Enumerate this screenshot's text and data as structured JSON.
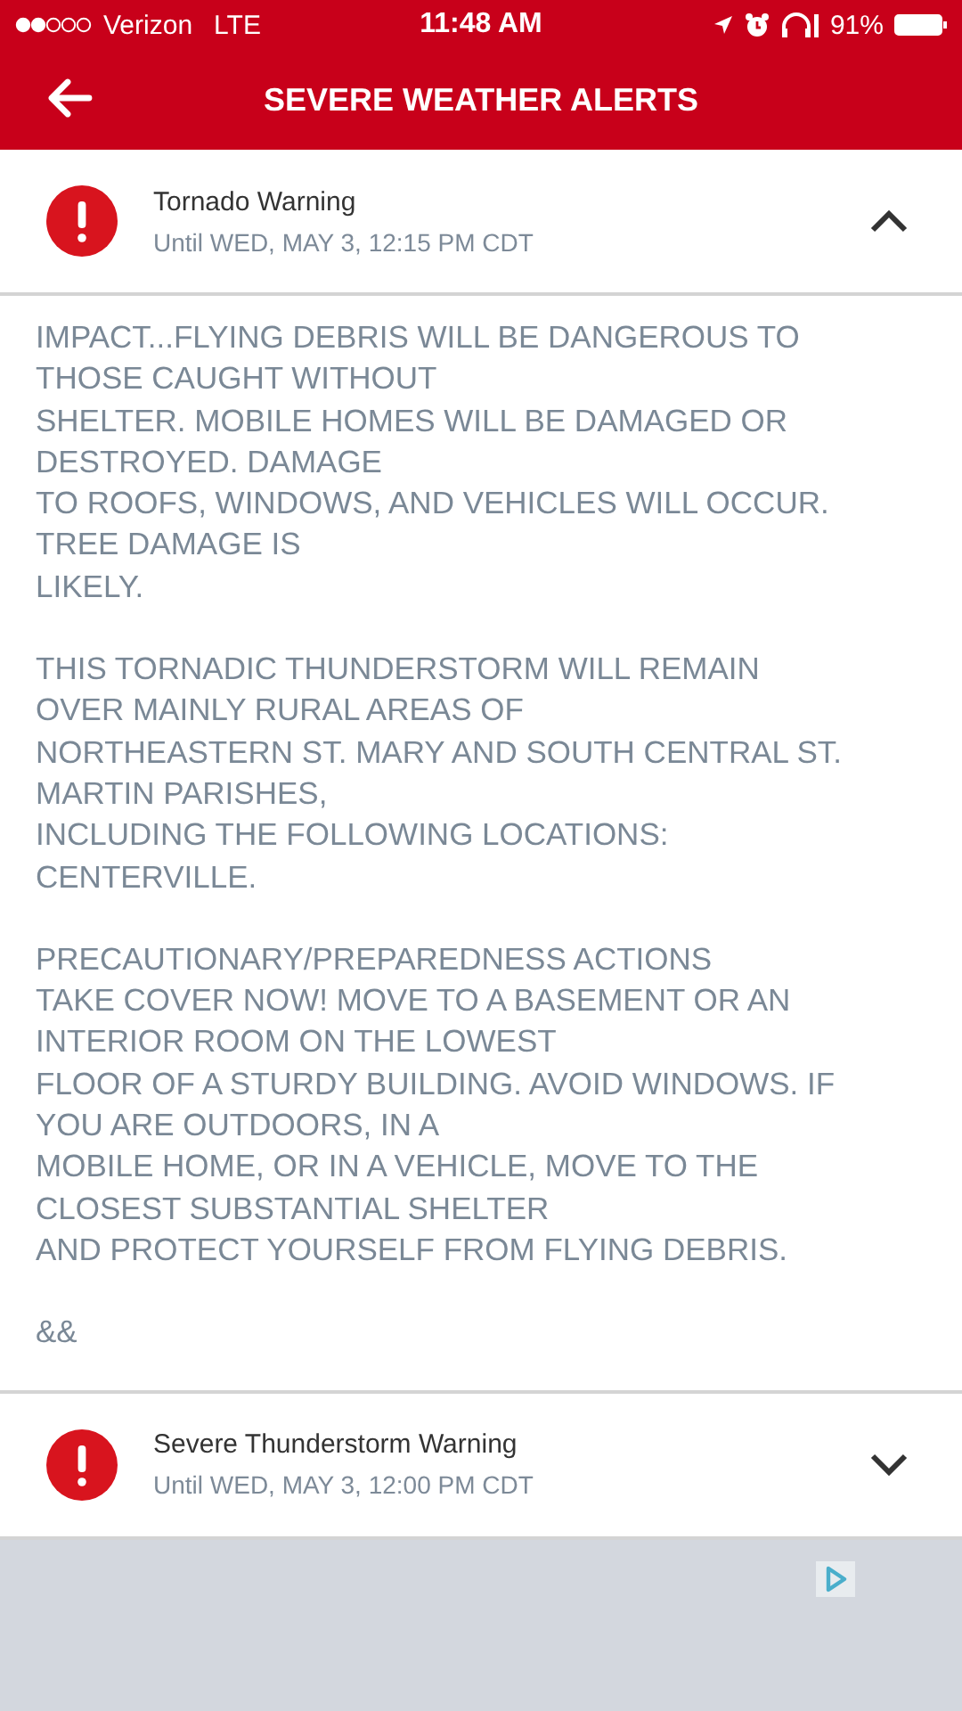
{
  "status_bar": {
    "carrier": "Verizon",
    "network": "LTE",
    "time": "11:48 AM",
    "battery": "91%"
  },
  "header": {
    "title": "SEVERE WEATHER ALERTS"
  },
  "alerts": [
    {
      "title": "Tornado Warning",
      "until": "Until WED, MAY 3, 12:15 PM CDT",
      "expanded": true,
      "paragraphs": [
        [
          "IMPACT...FLYING DEBRIS WILL BE DANGEROUS TO",
          "THOSE CAUGHT WITHOUT",
          "SHELTER. MOBILE HOMES WILL BE DAMAGED OR",
          "DESTROYED. DAMAGE",
          "TO ROOFS, WINDOWS, AND VEHICLES WILL OCCUR.",
          "TREE DAMAGE IS",
          "LIKELY."
        ],
        [
          "THIS TORNADIC THUNDERSTORM WILL REMAIN",
          "OVER MAINLY RURAL AREAS OF",
          "NORTHEASTERN ST. MARY AND SOUTH CENTRAL ST.",
          "MARTIN PARISHES,",
          "INCLUDING THE FOLLOWING LOCATIONS:",
          "CENTERVILLE."
        ],
        [
          "PRECAUTIONARY/PREPAREDNESS ACTIONS",
          "TAKE COVER NOW! MOVE TO A BASEMENT OR AN",
          "INTERIOR ROOM ON THE LOWEST",
          "FLOOR OF A STURDY BUILDING. AVOID WINDOWS. IF",
          "YOU ARE OUTDOORS, IN A",
          "MOBILE HOME, OR IN A VEHICLE, MOVE TO THE",
          "CLOSEST SUBSTANTIAL SHELTER",
          "AND PROTECT YOURSELF FROM FLYING DEBRIS."
        ],
        [
          "&&"
        ]
      ]
    },
    {
      "title": "Severe Thunderstorm Warning",
      "until": "Until WED, MAY 3, 12:00 PM CDT",
      "expanded": false
    }
  ]
}
